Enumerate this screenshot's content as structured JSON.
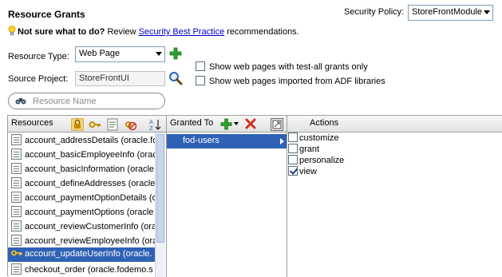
{
  "header": {
    "title": "Resource Grants",
    "security_policy_label": "Security Policy:",
    "security_policy_value": "StoreFrontModule"
  },
  "hint": {
    "bold": "Not sure what to do?",
    "pre": "Review",
    "link": "Security Best Practice",
    "post": "recommendations."
  },
  "form": {
    "resource_type_label": "Resource Type:",
    "resource_type_value": "Web Page",
    "source_project_label": "Source Project:",
    "source_project_value": "StoreFrontUI",
    "show_test_all_label": "Show web pages with test-all grants only",
    "show_adf_label": "Show web pages imported from ADF libraries"
  },
  "search": {
    "placeholder": "Resource Name"
  },
  "resources": {
    "header": "Resources",
    "items": [
      "account_addressDetails (oracle.fo",
      "account_basicEmployeeInfo (oracle",
      "account_basicInformation (oracle.",
      "account_defineAddresses (oracle.",
      "account_paymentOptionDetails (o",
      "account_paymentOptions (oracle",
      "account_reviewCustomerInfo (ora",
      "account_reviewEmployeeInfo (ora",
      "account_updateUserInfo (oracle.",
      "checkout_order (oracle.fodemo.s"
    ],
    "selected_index": 8
  },
  "granted_to": {
    "header": "Granted To",
    "items": [
      "fod-users"
    ]
  },
  "actions": {
    "header": "Actions",
    "items": [
      {
        "label": "customize",
        "checked": false
      },
      {
        "label": "grant",
        "checked": false
      },
      {
        "label": "personalize",
        "checked": false
      },
      {
        "label": "view",
        "checked": true
      }
    ]
  },
  "icons": {
    "add": "plus-icon",
    "remove": "delete-x-icon",
    "search": "binoculars-icon",
    "browse": "magnifier-icon",
    "hint": "lightbulb-icon"
  },
  "colors": {
    "selection": "#2f62b5",
    "link": "#0000cc",
    "add_green": "#2ea02e",
    "delete_red": "#d22b1f"
  }
}
